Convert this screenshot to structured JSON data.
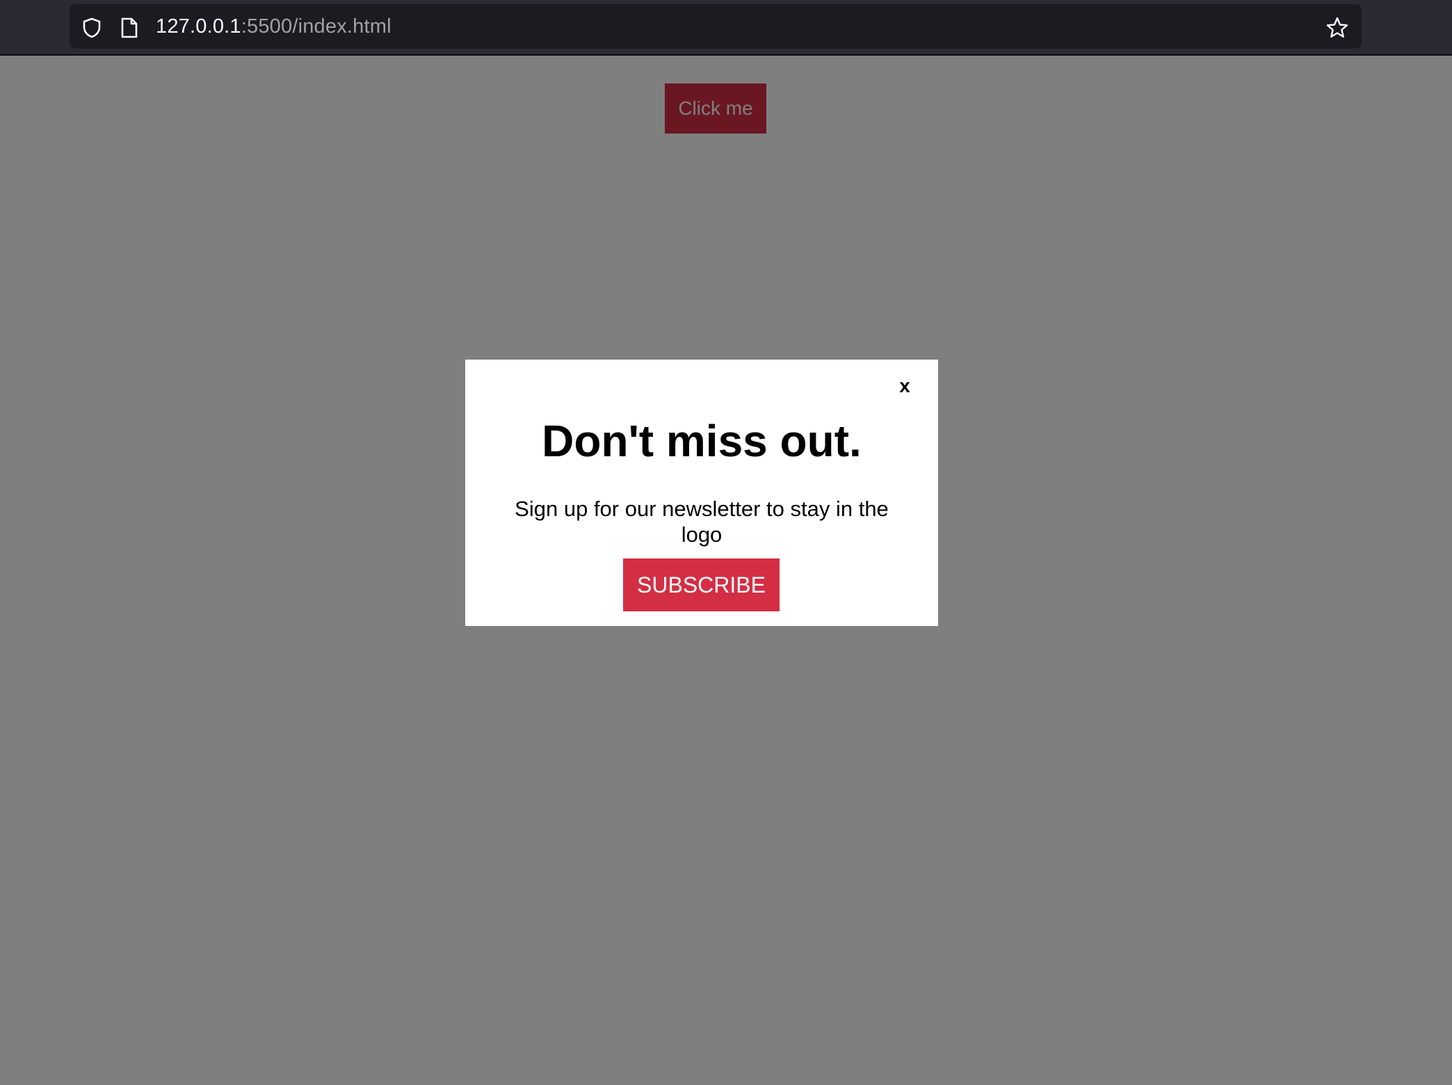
{
  "browser": {
    "url_host": "127.0.0.1",
    "url_rest": ":5500/index.html"
  },
  "page": {
    "click_button_label": "Click me"
  },
  "modal": {
    "close_label": "x",
    "title": "Don't miss out.",
    "message": "Sign up for our newsletter to stay in the logo",
    "subscribe_label": "SUBSCRIBE"
  },
  "colors": {
    "accent": "#d42e45",
    "overlay": "rgba(0,0,0,0.5)"
  }
}
